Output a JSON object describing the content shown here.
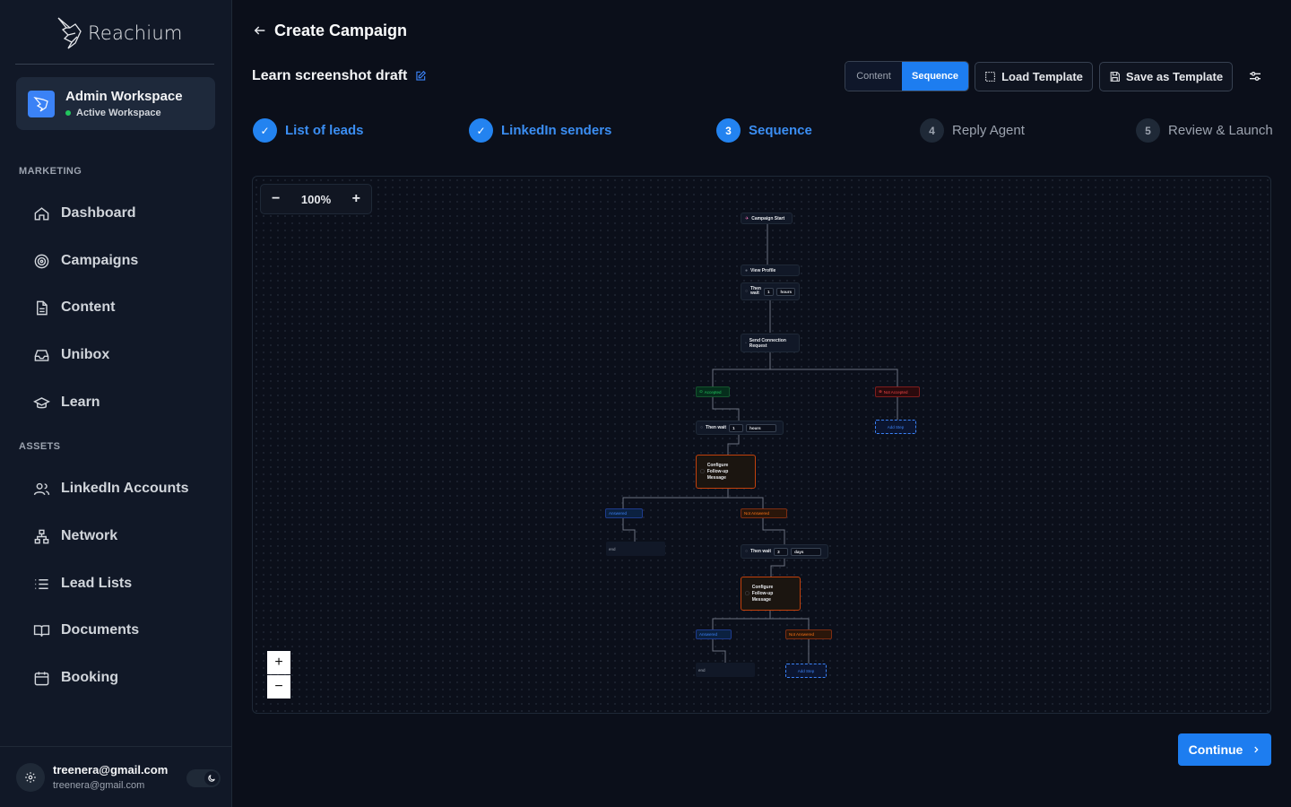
{
  "app": {
    "name": "Reachium"
  },
  "workspace": {
    "name": "Admin Workspace",
    "status": "Active Workspace"
  },
  "sidebar": {
    "sections": [
      {
        "label": "MARKETING",
        "items": [
          {
            "label": "Dashboard",
            "icon": "home-icon"
          },
          {
            "label": "Campaigns",
            "icon": "target-icon"
          },
          {
            "label": "Content",
            "icon": "document-icon"
          },
          {
            "label": "Unibox",
            "icon": "inbox-icon"
          },
          {
            "label": "Learn",
            "icon": "graduation-cap-icon"
          }
        ]
      },
      {
        "label": "ASSETS",
        "items": [
          {
            "label": "LinkedIn Accounts",
            "icon": "users-icon"
          },
          {
            "label": "Network",
            "icon": "network-icon"
          },
          {
            "label": "Lead Lists",
            "icon": "list-icon"
          },
          {
            "label": "Documents",
            "icon": "book-icon"
          },
          {
            "label": "Booking",
            "icon": "calendar-icon"
          }
        ]
      }
    ]
  },
  "user": {
    "email": "treenera@gmail.com",
    "sub": "treenera@gmail.com"
  },
  "header": {
    "title": "Create Campaign",
    "draft_name": "Learn screenshot draft"
  },
  "view_toggle": {
    "options": [
      "Content",
      "Sequence"
    ],
    "selected": "Sequence"
  },
  "toolbar": {
    "load_template": "Load Template",
    "save_template": "Save as Template"
  },
  "stepper": [
    {
      "num": "✓",
      "label": "List of leads",
      "state": "done"
    },
    {
      "num": "✓",
      "label": "LinkedIn senders",
      "state": "done"
    },
    {
      "num": "3",
      "label": "Sequence",
      "state": "active"
    },
    {
      "num": "4",
      "label": "Reply Agent",
      "state": "todo"
    },
    {
      "num": "5",
      "label": "Review & Launch",
      "state": "todo"
    }
  ],
  "canvas": {
    "zoom": "100%",
    "nodes": {
      "start": "Campaign Start",
      "view_profile": "View Profile",
      "then_wait_1": {
        "label": "Then wait",
        "value": "1",
        "unit": "hours"
      },
      "connect": "Send Connection Request",
      "accepted": "Accepted",
      "not_accepted": "Not Accepted",
      "add_step_1": "Add Step",
      "then_wait_2": {
        "label": "Then wait",
        "value": "1",
        "unit": "hours"
      },
      "followup_1": "Configure Follow-up Message",
      "answered_1": "Answered",
      "not_answered_1": "Not Answered",
      "end_1": "end",
      "then_wait_3": {
        "label": "Then wait",
        "value": "3",
        "unit": "days"
      },
      "followup_2": "Configure Follow-up Message",
      "answered_2": "Answered",
      "not_answered_2": "Not Answered",
      "end_2": "end",
      "add_step_2": "Add Step"
    }
  },
  "footer": {
    "continue": "Continue"
  },
  "colors": {
    "accent": "#1d7df0",
    "background": "#0b0f1a",
    "sidebar": "#111827"
  }
}
